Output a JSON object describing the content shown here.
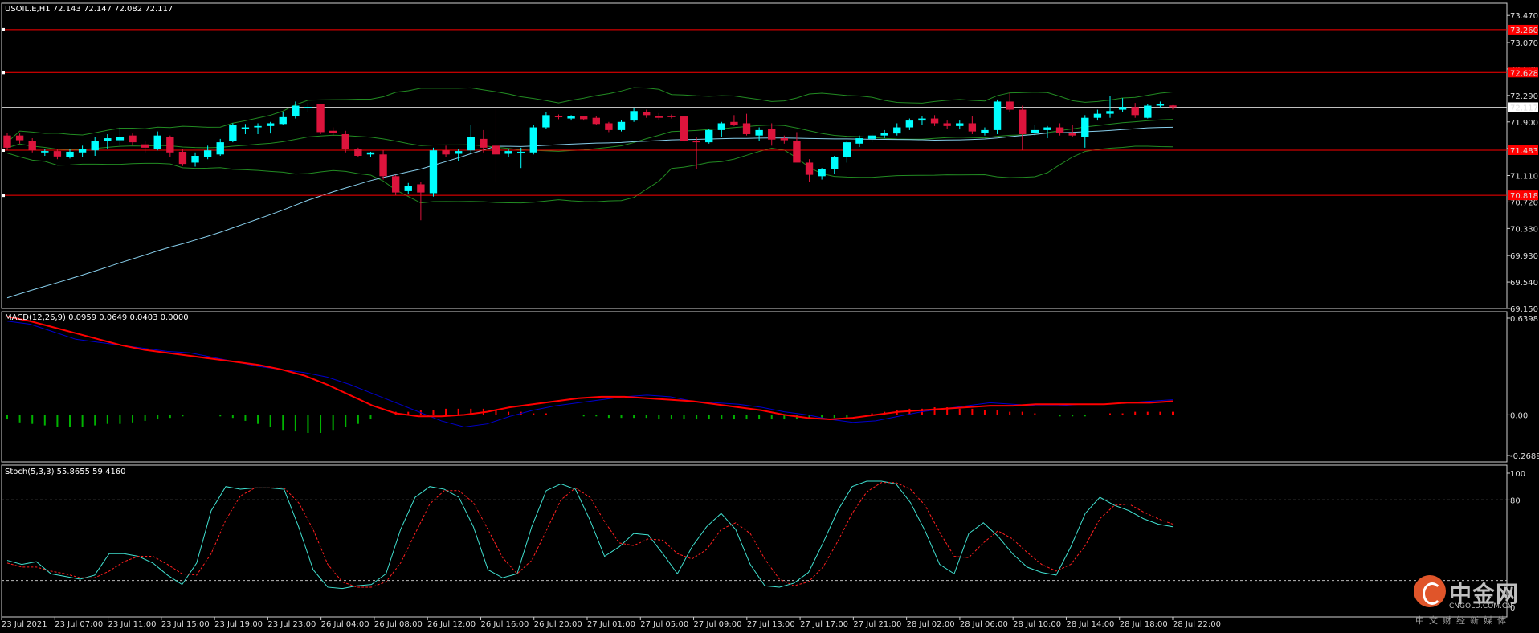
{
  "main_panel": {
    "header": "USOIL.E,H1  72.143 72.147 72.082 72.117",
    "price_ticks": [
      "73.470",
      "73.070",
      "72.680",
      "72.290",
      "71.900",
      "71.510",
      "71.110",
      "70.720",
      "70.330",
      "69.930",
      "69.540",
      "69.150"
    ],
    "h_lines": [
      {
        "label": "73.260",
        "value": 73.26
      },
      {
        "label": "72.628",
        "value": 72.628
      },
      {
        "label": "71.483",
        "value": 71.483
      },
      {
        "label": "70.818",
        "value": 70.818
      }
    ],
    "current_price_label": "72.117",
    "current_price": 72.117
  },
  "macd_panel": {
    "header": "MACD(12,26,9) 0.0959 0.0649 0.0403 0.0000",
    "ticks": [
      "0.6398",
      "0.00",
      "-0.2689"
    ]
  },
  "stoch_panel": {
    "header": "Stoch(5,3,3) 55.8655 59.4160",
    "ticks": [
      "100",
      "80",
      "0"
    ]
  },
  "time_axis": [
    "23 Jul 2021",
    "23 Jul 07:00",
    "23 Jul 11:00",
    "23 Jul 15:00",
    "23 Jul 19:00",
    "23 Jul 23:00",
    "26 Jul 04:00",
    "26 Jul 08:00",
    "26 Jul 12:00",
    "26 Jul 16:00",
    "26 Jul 20:00",
    "27 Jul 01:00",
    "27 Jul 05:00",
    "27 Jul 09:00",
    "27 Jul 13:00",
    "27 Jul 17:00",
    "27 Jul 21:00",
    "28 Jul 02:00",
    "28 Jul 06:00",
    "28 Jul 10:00",
    "28 Jul 14:00",
    "28 Jul 18:00",
    "28 Jul 22:00"
  ],
  "logo": {
    "name": "中金网",
    "site": "CNGOLD.COM.CN",
    "tagline": "中文财经新媒体"
  },
  "colors": {
    "bull": "#00ffff",
    "bear": "#dc143c",
    "hline": "#ff0000",
    "macd_line": "#0000cd",
    "signal_line": "#ff0000",
    "ma": "#87ceeb",
    "bands": "#228b22"
  },
  "chart_data": [
    {
      "type": "candlestick",
      "title": "USOIL.E,H1",
      "ylim": [
        69.15,
        73.65
      ],
      "candles_ohlc": [
        [
          71.7,
          71.74,
          71.48,
          71.52
        ],
        [
          71.7,
          71.73,
          71.58,
          71.63
        ],
        [
          71.62,
          71.66,
          71.45,
          71.48
        ],
        [
          71.45,
          71.5,
          71.4,
          71.47
        ],
        [
          71.47,
          71.5,
          71.35,
          71.39
        ],
        [
          71.38,
          71.5,
          71.36,
          71.46
        ],
        [
          71.45,
          71.55,
          71.38,
          71.5
        ],
        [
          71.48,
          71.68,
          71.4,
          71.62
        ],
        [
          71.62,
          71.72,
          71.5,
          71.66
        ],
        [
          71.63,
          71.82,
          71.55,
          71.68
        ],
        [
          71.7,
          71.73,
          71.55,
          71.6
        ],
        [
          71.57,
          71.62,
          71.45,
          71.52
        ],
        [
          71.5,
          71.76,
          71.48,
          71.7
        ],
        [
          71.68,
          71.7,
          71.38,
          71.45
        ],
        [
          71.46,
          71.5,
          71.25,
          71.28
        ],
        [
          71.3,
          71.45,
          71.24,
          71.4
        ],
        [
          71.38,
          71.55,
          71.35,
          71.48
        ],
        [
          71.42,
          71.65,
          71.4,
          71.6
        ],
        [
          71.62,
          71.88,
          71.6,
          71.86
        ],
        [
          71.8,
          71.87,
          71.72,
          71.82
        ],
        [
          71.82,
          71.88,
          71.72,
          71.84
        ],
        [
          71.84,
          71.9,
          71.73,
          71.88
        ],
        [
          71.87,
          72.05,
          71.85,
          71.97
        ],
        [
          71.98,
          72.2,
          71.95,
          72.14
        ],
        [
          72.1,
          72.18,
          72.05,
          72.12
        ],
        [
          72.16,
          72.17,
          71.72,
          71.75
        ],
        [
          71.77,
          71.82,
          71.7,
          71.74
        ],
        [
          71.72,
          71.77,
          71.45,
          71.5
        ],
        [
          71.5,
          71.52,
          71.38,
          71.4
        ],
        [
          71.42,
          71.46,
          71.38,
          71.45
        ],
        [
          71.42,
          71.48,
          71.05,
          71.1
        ],
        [
          71.1,
          71.12,
          70.82,
          70.86
        ],
        [
          70.88,
          71.0,
          70.84,
          70.96
        ],
        [
          70.98,
          71.02,
          70.45,
          70.86
        ],
        [
          70.85,
          71.52,
          70.8,
          71.48
        ],
        [
          71.48,
          71.55,
          71.38,
          71.42
        ],
        [
          71.43,
          71.5,
          71.32,
          71.47
        ],
        [
          71.48,
          71.85,
          71.45,
          71.68
        ],
        [
          71.65,
          71.78,
          71.45,
          71.52
        ],
        [
          71.55,
          72.12,
          71.02,
          71.42
        ],
        [
          71.43,
          71.5,
          71.38,
          71.47
        ],
        [
          71.45,
          71.52,
          71.22,
          71.46
        ],
        [
          71.45,
          71.85,
          71.42,
          71.82
        ],
        [
          71.82,
          72.05,
          71.8,
          72.0
        ],
        [
          71.98,
          72.01,
          71.94,
          71.97
        ],
        [
          71.95,
          72.0,
          71.92,
          71.98
        ],
        [
          71.98,
          71.99,
          71.92,
          71.94
        ],
        [
          71.96,
          71.98,
          71.85,
          71.87
        ],
        [
          71.88,
          71.9,
          71.75,
          71.78
        ],
        [
          71.78,
          71.93,
          71.76,
          71.9
        ],
        [
          71.92,
          72.1,
          71.9,
          72.06
        ],
        [
          72.04,
          72.08,
          71.96,
          72.0
        ],
        [
          71.98,
          72.03,
          71.93,
          71.96
        ],
        [
          71.99,
          72.01,
          71.95,
          71.97
        ],
        [
          71.98,
          72.0,
          71.58,
          71.62
        ],
        [
          71.62,
          71.68,
          71.2,
          71.6
        ],
        [
          71.6,
          71.8,
          71.58,
          71.78
        ],
        [
          71.78,
          71.9,
          71.68,
          71.88
        ],
        [
          71.9,
          72.0,
          71.84,
          71.86
        ],
        [
          71.88,
          72.02,
          71.7,
          71.72
        ],
        [
          71.7,
          71.82,
          71.62,
          71.78
        ],
        [
          71.8,
          71.88,
          71.55,
          71.64
        ],
        [
          71.66,
          71.7,
          71.58,
          71.63
        ],
        [
          71.62,
          71.75,
          71.36,
          71.3
        ],
        [
          71.3,
          71.35,
          71.02,
          71.12
        ],
        [
          71.1,
          71.22,
          71.05,
          71.2
        ],
        [
          71.2,
          71.4,
          71.13,
          71.38
        ],
        [
          71.38,
          71.62,
          71.3,
          71.6
        ],
        [
          71.58,
          71.7,
          71.53,
          71.66
        ],
        [
          71.65,
          71.72,
          71.6,
          71.7
        ],
        [
          71.7,
          71.78,
          71.66,
          71.74
        ],
        [
          71.73,
          71.88,
          71.7,
          71.82
        ],
        [
          71.82,
          71.95,
          71.78,
          71.92
        ],
        [
          71.92,
          71.98,
          71.86,
          71.95
        ],
        [
          71.95,
          72.0,
          71.84,
          71.88
        ],
        [
          71.88,
          71.92,
          71.8,
          71.84
        ],
        [
          71.84,
          71.92,
          71.79,
          71.88
        ],
        [
          71.88,
          71.98,
          71.72,
          71.76
        ],
        [
          71.74,
          71.82,
          71.7,
          71.78
        ],
        [
          71.78,
          72.23,
          71.72,
          72.2
        ],
        [
          72.2,
          72.33,
          72.04,
          72.08
        ],
        [
          72.08,
          72.14,
          71.48,
          71.72
        ],
        [
          71.74,
          71.86,
          71.7,
          71.78
        ],
        [
          71.78,
          71.84,
          71.66,
          71.82
        ],
        [
          71.82,
          71.88,
          71.7,
          71.74
        ],
        [
          71.74,
          71.86,
          71.68,
          71.7
        ],
        [
          71.68,
          72.0,
          71.52,
          71.96
        ],
        [
          71.96,
          72.08,
          71.92,
          72.02
        ],
        [
          72.02,
          72.28,
          71.96,
          72.06
        ],
        [
          72.08,
          72.25,
          72.04,
          72.12
        ],
        [
          72.12,
          72.18,
          71.96,
          72.0
        ],
        [
          71.96,
          72.16,
          71.95,
          72.14
        ],
        [
          72.14,
          72.2,
          72.1,
          72.16
        ],
        [
          72.143,
          72.147,
          72.082,
          72.117
        ]
      ]
    },
    {
      "type": "line",
      "title": "MACD(12,26,9)",
      "series": [
        {
          "name": "MACD",
          "values": [
            0.62,
            0.6,
            0.55,
            0.5,
            0.48,
            0.46,
            0.44,
            0.42,
            0.41,
            0.38,
            0.35,
            0.32,
            0.3,
            0.28,
            0.25,
            0.2,
            0.14,
            0.08,
            0.02,
            -0.04,
            -0.08,
            -0.06,
            -0.01,
            0.03,
            0.06,
            0.08,
            0.1,
            0.12,
            0.13,
            0.12,
            0.09,
            0.08,
            0.07,
            0.05,
            0.02,
            0.0,
            -0.03,
            -0.05,
            -0.04,
            -0.01,
            0.02,
            0.04,
            0.06,
            0.08,
            0.07,
            0.06,
            0.06,
            0.07,
            0.07,
            0.08,
            0.09,
            0.1
          ]
        },
        {
          "name": "Signal",
          "values": [
            0.65,
            0.62,
            0.58,
            0.54,
            0.5,
            0.46,
            0.43,
            0.41,
            0.39,
            0.37,
            0.35,
            0.33,
            0.3,
            0.26,
            0.2,
            0.13,
            0.06,
            0.01,
            -0.01,
            -0.01,
            0.0,
            0.02,
            0.05,
            0.07,
            0.09,
            0.11,
            0.12,
            0.12,
            0.11,
            0.1,
            0.09,
            0.07,
            0.05,
            0.03,
            0.0,
            -0.02,
            -0.03,
            -0.02,
            0.0,
            0.02,
            0.03,
            0.04,
            0.05,
            0.06,
            0.06,
            0.07,
            0.07,
            0.07,
            0.07,
            0.08,
            0.08,
            0.09
          ]
        }
      ],
      "histogram": [
        -0.03,
        -0.05,
        -0.06,
        -0.07,
        -0.08,
        -0.08,
        -0.08,
        -0.07,
        -0.06,
        -0.06,
        -0.05,
        -0.04,
        -0.03,
        -0.02,
        -0.01,
        0.0,
        0.0,
        -0.01,
        -0.02,
        -0.04,
        -0.06,
        -0.08,
        -0.1,
        -0.11,
        -0.12,
        -0.12,
        -0.1,
        -0.08,
        -0.06,
        -0.03,
        0.0,
        0.02,
        0.02,
        0.03,
        0.03,
        0.04,
        0.04,
        0.04,
        0.04,
        0.03,
        0.02,
        0.02,
        0.01,
        0.01,
        0.0,
        0.0,
        -0.01,
        -0.01,
        -0.02,
        -0.02,
        -0.02,
        -0.02,
        -0.03,
        -0.03,
        -0.03,
        -0.03,
        -0.03,
        -0.03,
        -0.03,
        -0.03,
        -0.03,
        -0.03,
        -0.03,
        -0.03,
        -0.03,
        -0.03,
        -0.02,
        -0.02,
        0.0,
        0.01,
        0.02,
        0.03,
        0.04,
        0.04,
        0.05,
        0.05,
        0.04,
        0.04,
        0.03,
        0.03,
        0.02,
        0.02,
        0.01,
        0.0,
        -0.01,
        -0.01,
        -0.01,
        0.0,
        0.01,
        0.01,
        0.02,
        0.02,
        0.02,
        0.02
      ],
      "ylim": [
        -0.2689,
        0.6398
      ]
    },
    {
      "type": "line",
      "title": "Stoch(5,3,3)",
      "series": [
        {
          "name": "%K",
          "values": [
            35,
            32,
            34,
            25,
            23,
            21,
            24,
            40,
            40,
            38,
            33,
            24,
            17,
            33,
            72,
            90,
            88,
            89,
            89,
            88,
            60,
            28,
            15,
            14,
            16,
            17,
            25,
            58,
            82,
            90,
            88,
            82,
            60,
            28,
            22,
            25,
            60,
            87,
            92,
            88,
            65,
            38,
            45,
            55,
            54,
            40,
            25,
            45,
            60,
            70,
            58,
            32,
            16,
            15,
            18,
            26,
            48,
            72,
            90,
            94,
            94,
            92,
            78,
            57,
            32,
            25,
            55,
            63,
            53,
            40,
            30,
            26,
            24,
            45,
            70,
            82,
            76,
            72,
            66,
            62,
            60
          ]
        },
        {
          "name": "%D",
          "values": [
            33,
            30,
            30,
            27,
            25,
            22,
            22,
            27,
            34,
            38,
            38,
            32,
            25,
            24,
            40,
            65,
            83,
            89,
            89,
            89,
            78,
            58,
            32,
            19,
            15,
            15,
            19,
            33,
            55,
            77,
            87,
            87,
            78,
            58,
            37,
            25,
            35,
            57,
            80,
            89,
            82,
            64,
            48,
            46,
            51,
            50,
            40,
            36,
            43,
            58,
            63,
            55,
            36,
            21,
            16,
            19,
            30,
            49,
            70,
            86,
            93,
            93,
            88,
            76,
            56,
            38,
            37,
            48,
            57,
            51,
            41,
            32,
            27,
            32,
            46,
            66,
            76,
            77,
            71,
            66,
            62
          ]
        }
      ],
      "ylim": [
        0,
        100
      ],
      "levels": [
        80,
        20
      ]
    }
  ]
}
